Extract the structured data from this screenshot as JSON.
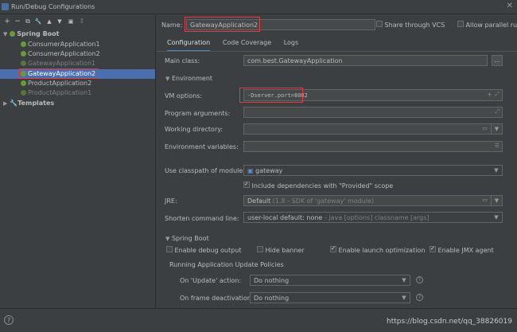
{
  "window": {
    "title": "Run/Debug Configurations"
  },
  "toolbar": {
    "icons": [
      "plus-icon",
      "minus-icon",
      "copy-icon",
      "wrench-icon",
      "arrow-up-icon",
      "arrow-down-icon",
      "folder-icon",
      "sort-icon"
    ],
    "glyphs": [
      "+",
      "−",
      "⧉",
      "🔧",
      "▲",
      "▼",
      "▣",
      "↕"
    ]
  },
  "tree": {
    "spring_boot": "Spring Boot",
    "items": [
      "ConsumerApplication1",
      "ConsumerApplication2",
      "GatewayApplication1",
      "GatewayApplication2",
      "ProductApplication2",
      "ProductApplication1"
    ],
    "templates": "Templates"
  },
  "header": {
    "name_label": "Name:",
    "name_value": "GatewayApplication2",
    "share_vcs": "Share through VCS",
    "allow_parallel": "Allow parallel run"
  },
  "tabs": [
    "Configuration",
    "Code Coverage",
    "Logs"
  ],
  "config": {
    "main_class_label": "Main class:",
    "main_class_value": "com.best.GatewayApplication",
    "environment": "Environment",
    "vm_options_label": "VM options:",
    "vm_options_value": "-Dserver.port=8082",
    "program_args_label": "Program arguments:",
    "working_dir_label": "Working directory:",
    "env_vars_label": "Environment variables:",
    "classpath_label": "Use classpath of module:",
    "classpath_value": "gateway",
    "include_provided": "Include dependencies with \"Provided\" scope",
    "jre_label": "JRE:",
    "jre_value": "Default",
    "jre_hint": "(1.8 - SDK of 'gateway' module)",
    "shorten_label": "Shorten command line:",
    "shorten_value": "user-local default: none",
    "shorten_hint": "- java [options] classname [args]",
    "ellipsis": "..."
  },
  "spring": {
    "section": "Spring Boot",
    "enable_debug": "Enable debug output",
    "hide_banner": "Hide banner",
    "launch_opt": "Enable launch optimization",
    "jmx": "Enable JMX agent",
    "policies": "Running Application Update Policies",
    "on_update_label": "On 'Update' action:",
    "on_update_value": "Do nothing",
    "on_frame_label": "On frame deactivation:",
    "on_frame_value": "Do nothing"
  },
  "footer": {
    "help": "?",
    "watermark": "https://blog.csdn.net/qq_38826019"
  }
}
